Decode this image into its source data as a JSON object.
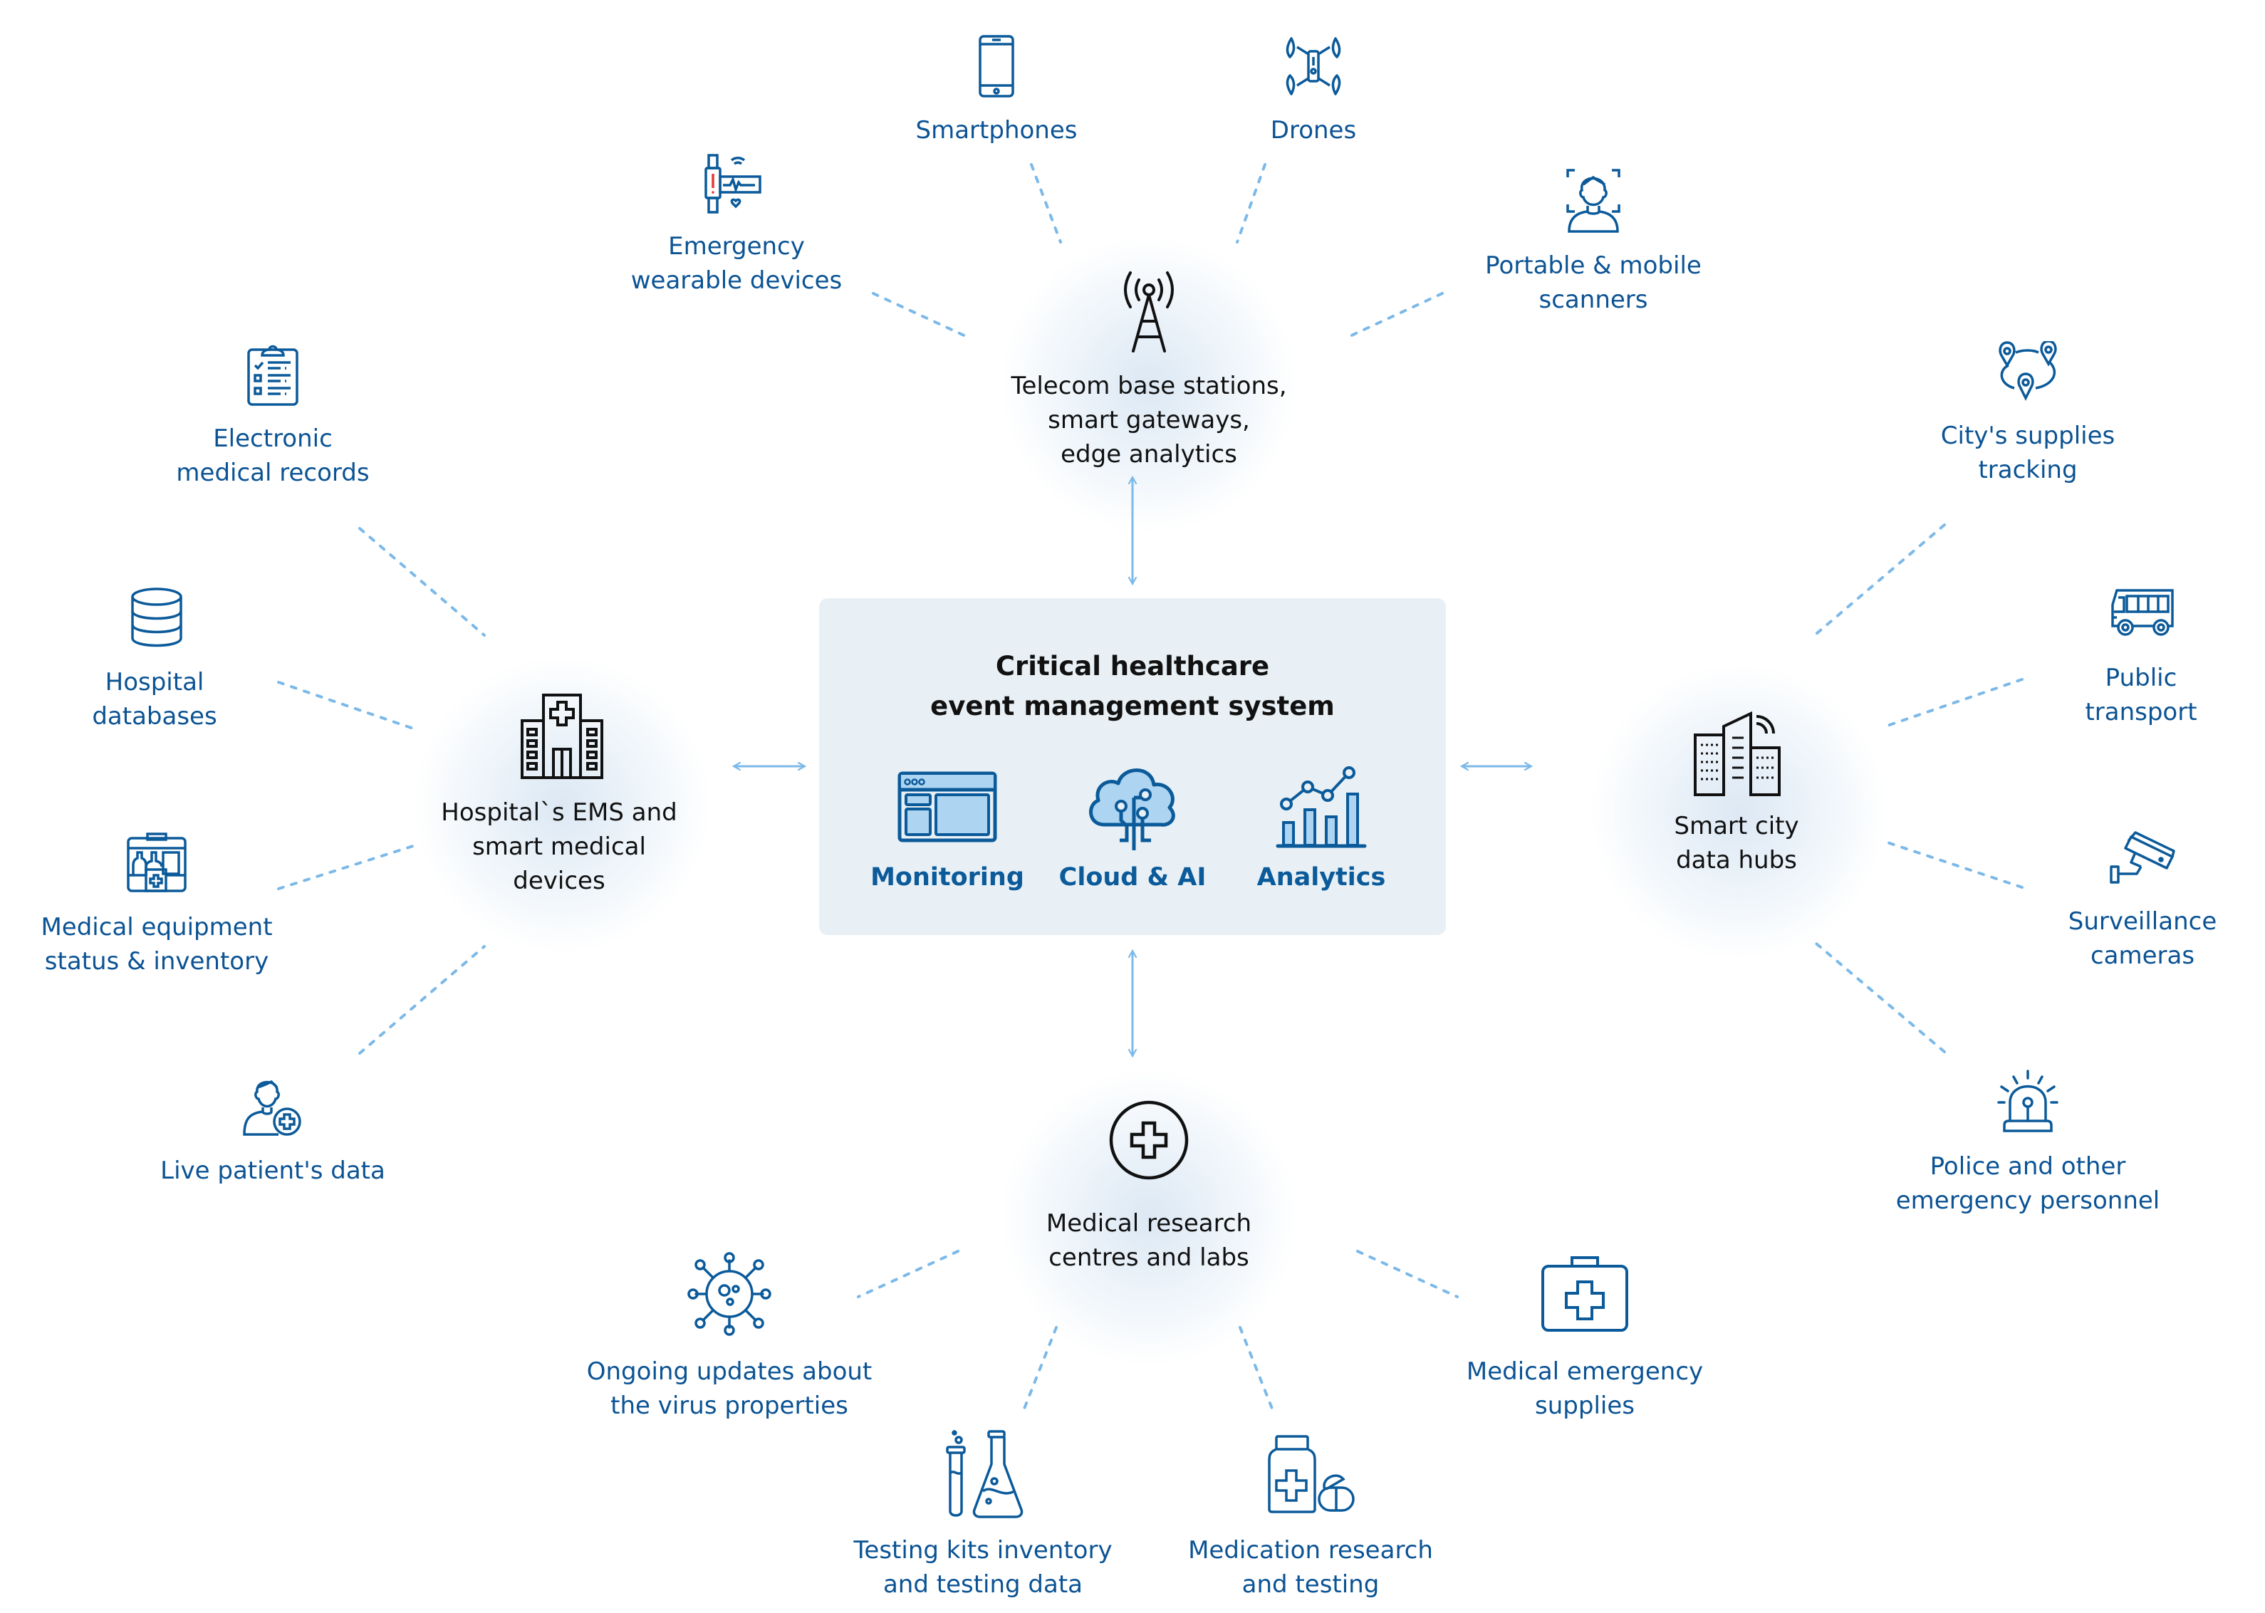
{
  "colors": {
    "node_text": "#0b5394",
    "hub_text": "#111111",
    "connector": "#7cb9e8",
    "icon_stroke": "#0b5a9a",
    "icon_fill": "#add4f0",
    "center_box_bg": "#e8f0f5",
    "alert_red": "#e53935"
  },
  "center": {
    "title_line1": "Critical healthcare",
    "title_line2": "event management system",
    "modules": [
      {
        "label": "Monitoring",
        "icon": "dashboard-window-icon"
      },
      {
        "label": "Cloud & AI",
        "icon": "cloud-circuit-icon"
      },
      {
        "label": "Analytics",
        "icon": "bar-line-chart-icon"
      }
    ]
  },
  "hubs": {
    "top": {
      "lines": [
        "Telecom base stations,",
        "smart gateways,",
        "edge analytics"
      ],
      "icon": "cell-tower-icon"
    },
    "left": {
      "lines": [
        "Hospital`s EMS and",
        "smart medical",
        "devices"
      ],
      "icon": "hospital-building-icon"
    },
    "right": {
      "lines": [
        "Smart city",
        "data hubs"
      ],
      "icon": "city-buildings-icon"
    },
    "bottom": {
      "lines": [
        "Medical research",
        "centres and labs"
      ],
      "icon": "medical-cross-circle-icon"
    }
  },
  "nodes": {
    "top": [
      {
        "lines": [
          "Emergency",
          "wearable devices"
        ],
        "icon": "smartwatch-alert-icon"
      },
      {
        "lines": [
          "Smartphones"
        ],
        "icon": "smartphone-icon"
      },
      {
        "lines": [
          "Drones"
        ],
        "icon": "drone-icon"
      },
      {
        "lines": [
          "Portable & mobile",
          "scanners"
        ],
        "icon": "face-scan-icon"
      }
    ],
    "left": [
      {
        "lines": [
          "Electronic",
          "medical records"
        ],
        "icon": "clipboard-checklist-icon"
      },
      {
        "lines": [
          "Hospital",
          "databases"
        ],
        "icon": "database-icon"
      },
      {
        "lines": [
          "Medical equipment",
          "status & inventory"
        ],
        "icon": "medical-cabinet-icon"
      },
      {
        "lines": [
          "Live patient's data"
        ],
        "icon": "patient-plus-icon"
      }
    ],
    "right": [
      {
        "lines": [
          "City's supplies",
          "tracking"
        ],
        "icon": "map-pins-route-icon"
      },
      {
        "lines": [
          "Public",
          "transport"
        ],
        "icon": "bus-icon"
      },
      {
        "lines": [
          "Surveillance",
          "cameras"
        ],
        "icon": "cctv-camera-icon"
      },
      {
        "lines": [
          "Police and other",
          "emergency personnel"
        ],
        "icon": "siren-light-icon"
      }
    ],
    "bottom": [
      {
        "lines": [
          "Ongoing updates about",
          "the virus properties"
        ],
        "icon": "virus-icon"
      },
      {
        "lines": [
          "Testing kits inventory",
          "and testing data"
        ],
        "icon": "test-tube-flask-icon"
      },
      {
        "lines": [
          "Medication research",
          "and testing"
        ],
        "icon": "pill-bottle-icon"
      },
      {
        "lines": [
          "Medical emergency",
          "supplies"
        ],
        "icon": "first-aid-kit-icon"
      }
    ]
  }
}
